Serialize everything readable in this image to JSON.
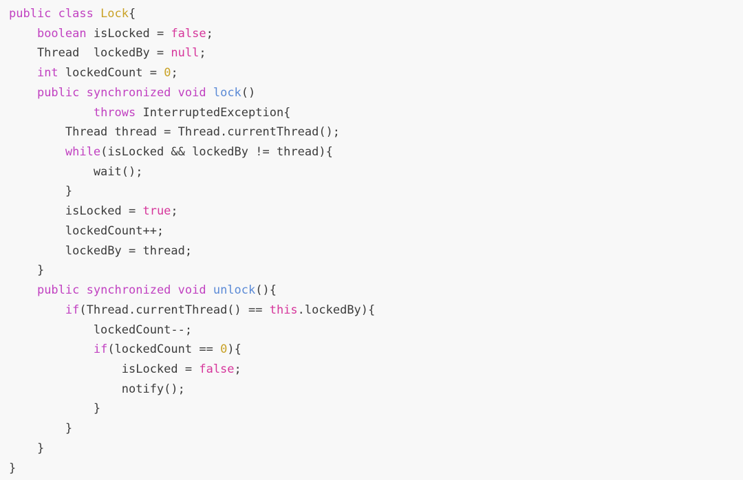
{
  "editor": {
    "language": "Java",
    "background_color": "#f8f8f8",
    "font_size_px": 17,
    "line_height_px": 28.72,
    "indent_unit_spaces": 4,
    "total_lines": 24
  },
  "theme": {
    "keyword_color": "#c141c1",
    "classname_color": "#c9a227",
    "literal_color": "#d6369b",
    "number_color": "#c9a227",
    "method_color": "#5b8ad6",
    "plain_color": "#3b3b3b",
    "background_color": "#f8f8f8"
  },
  "code": {
    "lines": [
      {
        "n": 1,
        "text": "public class Lock{",
        "tokens": [
          {
            "t": "public class ",
            "c": "keyword"
          },
          {
            "t": "Lock",
            "c": "classname"
          },
          {
            "t": "{",
            "c": "punct"
          }
        ]
      },
      {
        "n": 2,
        "text": "    boolean isLocked = false;",
        "tokens": [
          {
            "t": "    ",
            "c": "plain"
          },
          {
            "t": "boolean",
            "c": "keyword"
          },
          {
            "t": " isLocked = ",
            "c": "plain"
          },
          {
            "t": "false",
            "c": "literal"
          },
          {
            "t": ";",
            "c": "punct"
          }
        ]
      },
      {
        "n": 3,
        "text": "    Thread  lockedBy = null;",
        "tokens": [
          {
            "t": "    Thread  lockedBy = ",
            "c": "plain"
          },
          {
            "t": "null",
            "c": "literal"
          },
          {
            "t": ";",
            "c": "punct"
          }
        ]
      },
      {
        "n": 4,
        "text": "    int lockedCount = 0;",
        "tokens": [
          {
            "t": "    ",
            "c": "plain"
          },
          {
            "t": "int",
            "c": "keyword"
          },
          {
            "t": " lockedCount = ",
            "c": "plain"
          },
          {
            "t": "0",
            "c": "number"
          },
          {
            "t": ";",
            "c": "punct"
          }
        ]
      },
      {
        "n": 5,
        "text": "    public synchronized void lock()",
        "tokens": [
          {
            "t": "    ",
            "c": "plain"
          },
          {
            "t": "public synchronized void",
            "c": "keyword"
          },
          {
            "t": " ",
            "c": "plain"
          },
          {
            "t": "lock",
            "c": "method"
          },
          {
            "t": "()",
            "c": "punct"
          }
        ]
      },
      {
        "n": 6,
        "text": "            throws InterruptedException{",
        "tokens": [
          {
            "t": "            ",
            "c": "plain"
          },
          {
            "t": "throws",
            "c": "keyword"
          },
          {
            "t": " InterruptedException{",
            "c": "plain"
          }
        ]
      },
      {
        "n": 7,
        "text": "        Thread thread = Thread.currentThread();",
        "tokens": [
          {
            "t": "        Thread thread = Thread.currentThread();",
            "c": "plain"
          }
        ]
      },
      {
        "n": 8,
        "text": "        while(isLocked && lockedBy != thread){",
        "tokens": [
          {
            "t": "        ",
            "c": "plain"
          },
          {
            "t": "while",
            "c": "keyword"
          },
          {
            "t": "(isLocked && lockedBy != thread){",
            "c": "plain"
          }
        ]
      },
      {
        "n": 9,
        "text": "            wait();",
        "tokens": [
          {
            "t": "            wait();",
            "c": "plain"
          }
        ]
      },
      {
        "n": 10,
        "text": "        }",
        "tokens": [
          {
            "t": "        }",
            "c": "punct"
          }
        ]
      },
      {
        "n": 11,
        "text": "        isLocked = true;",
        "tokens": [
          {
            "t": "        isLocked = ",
            "c": "plain"
          },
          {
            "t": "true",
            "c": "literal"
          },
          {
            "t": ";",
            "c": "punct"
          }
        ]
      },
      {
        "n": 12,
        "text": "        lockedCount++;",
        "tokens": [
          {
            "t": "        lockedCount++;",
            "c": "plain"
          }
        ]
      },
      {
        "n": 13,
        "text": "        lockedBy = thread;",
        "tokens": [
          {
            "t": "        lockedBy = thread;",
            "c": "plain"
          }
        ]
      },
      {
        "n": 14,
        "text": "    }",
        "tokens": [
          {
            "t": "    }",
            "c": "punct"
          }
        ]
      },
      {
        "n": 15,
        "text": "    public synchronized void unlock(){",
        "tokens": [
          {
            "t": "    ",
            "c": "plain"
          },
          {
            "t": "public synchronized void",
            "c": "keyword"
          },
          {
            "t": " ",
            "c": "plain"
          },
          {
            "t": "unlock",
            "c": "method"
          },
          {
            "t": "(){",
            "c": "punct"
          }
        ]
      },
      {
        "n": 16,
        "text": "        if(Thread.currentThread() == this.lockedBy){",
        "tokens": [
          {
            "t": "        ",
            "c": "plain"
          },
          {
            "t": "if",
            "c": "keyword"
          },
          {
            "t": "(Thread.currentThread() == ",
            "c": "plain"
          },
          {
            "t": "this",
            "c": "this"
          },
          {
            "t": ".lockedBy){",
            "c": "plain"
          }
        ]
      },
      {
        "n": 17,
        "text": "            lockedCount--;",
        "tokens": [
          {
            "t": "            lockedCount--;",
            "c": "plain"
          }
        ]
      },
      {
        "n": 18,
        "text": "            if(lockedCount == 0){",
        "tokens": [
          {
            "t": "            ",
            "c": "plain"
          },
          {
            "t": "if",
            "c": "keyword"
          },
          {
            "t": "(lockedCount == ",
            "c": "plain"
          },
          {
            "t": "0",
            "c": "number"
          },
          {
            "t": "){",
            "c": "punct"
          }
        ]
      },
      {
        "n": 19,
        "text": "                isLocked = false;",
        "tokens": [
          {
            "t": "                isLocked = ",
            "c": "plain"
          },
          {
            "t": "false",
            "c": "literal"
          },
          {
            "t": ";",
            "c": "punct"
          }
        ]
      },
      {
        "n": 20,
        "text": "                notify();",
        "tokens": [
          {
            "t": "                notify();",
            "c": "plain"
          }
        ]
      },
      {
        "n": 21,
        "text": "            }",
        "tokens": [
          {
            "t": "            }",
            "c": "punct"
          }
        ]
      },
      {
        "n": 22,
        "text": "        }",
        "tokens": [
          {
            "t": "        }",
            "c": "punct"
          }
        ]
      },
      {
        "n": 23,
        "text": "    }",
        "tokens": [
          {
            "t": "    }",
            "c": "punct"
          }
        ]
      },
      {
        "n": 24,
        "text": "}",
        "tokens": [
          {
            "t": "}",
            "c": "punct"
          }
        ]
      }
    ]
  }
}
